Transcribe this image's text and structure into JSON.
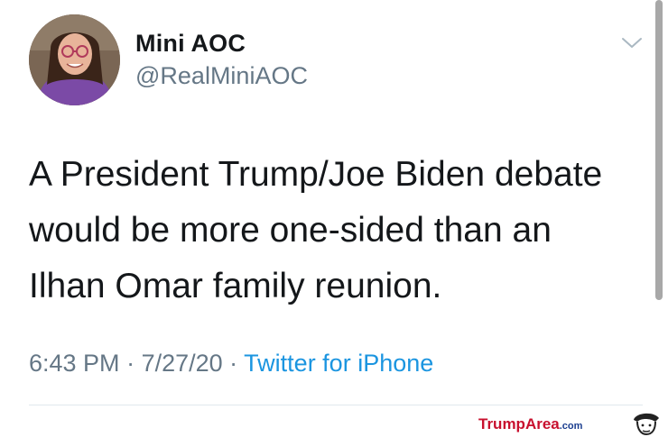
{
  "tweet": {
    "display_name": "Mini AOC",
    "handle": "@RealMiniAOC",
    "text": "A President Trump/Joe Biden debate\nwould be more one-sided than an\nIlhan Omar family reunion.",
    "time": "6:43 PM",
    "separator": " · ",
    "date": "7/27/20",
    "source": "Twitter for iPhone",
    "menu_icon": "chevron-down-icon"
  },
  "watermark": {
    "brand": "TrumpArea",
    "domain": ".com"
  },
  "colors": {
    "text_primary": "#14171a",
    "text_secondary": "#657786",
    "link": "#1b95e0",
    "watermark_red": "#c8102e",
    "watermark_blue": "#1a3d8f"
  }
}
